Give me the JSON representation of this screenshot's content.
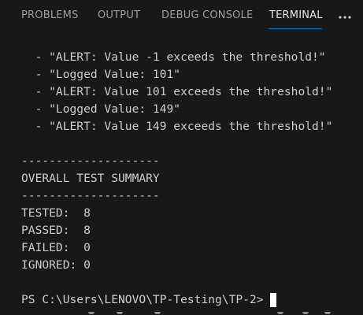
{
  "panel_tabs": [
    {
      "label": "PROBLEMS",
      "active": false
    },
    {
      "label": "OUTPUT",
      "active": false
    },
    {
      "label": "DEBUG CONSOLE",
      "active": false
    },
    {
      "label": "TERMINAL",
      "active": true
    }
  ],
  "more_actions_icon": "ellipsis-icon",
  "accent_color": "#0078d4",
  "terminal": {
    "lines": [
      "  - \"ALERT: Value -1 exceeds the threshold!\"",
      "  - \"Logged Value: 101\"",
      "  - \"ALERT: Value 101 exceeds the threshold!\"",
      "  - \"Logged Value: 149\"",
      "  - \"ALERT: Value 149 exceeds the threshold!\"",
      "",
      "--------------------",
      "OVERALL TEST SUMMARY",
      "--------------------",
      "TESTED:  8",
      "PASSED:  8",
      "FAILED:  0",
      "IGNORED: 0"
    ],
    "prompt": "PS C:\\Users\\LENOVO\\TP-Testing\\TP-2>"
  }
}
